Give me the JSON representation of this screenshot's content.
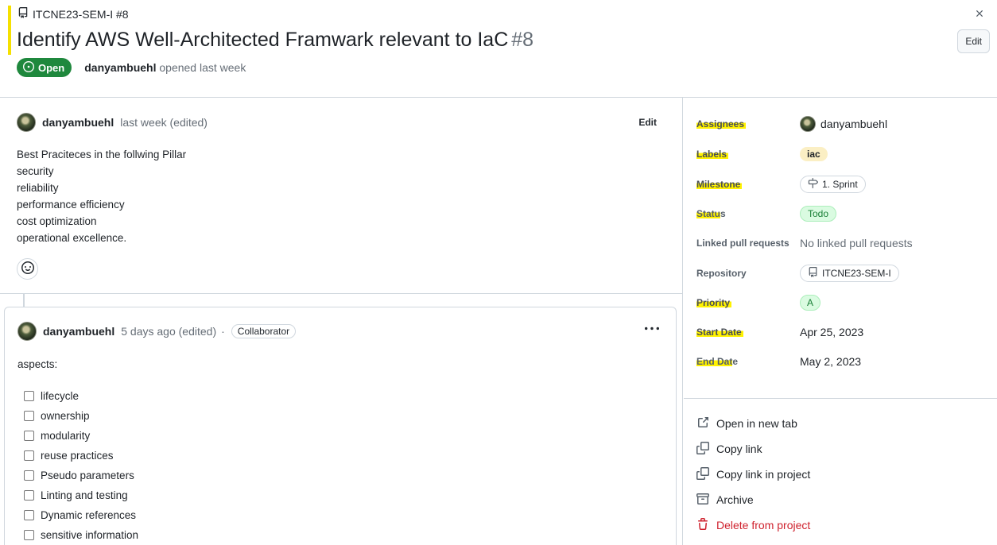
{
  "header": {
    "repo_ref": "ITCNE23-SEM-I #8",
    "title": "Identify AWS Well-Architected Framwark relevant to IaC",
    "number": "#8",
    "edit_label": "Edit",
    "state": "Open",
    "author": "danyambuehl",
    "opened_text": "opened last week"
  },
  "comment1": {
    "author": "danyambuehl",
    "meta": "last week (edited)",
    "edit_label": "Edit",
    "body_lines": [
      "Best Praciteces in the follwing Pillar",
      "security",
      "reliability",
      "performance efficiency",
      "cost optimization",
      "operational excellence."
    ]
  },
  "comment2": {
    "author": "danyambuehl",
    "meta": "5 days ago (edited)",
    "separator": "·",
    "badge": "Collaborator",
    "intro": "aspects:",
    "tasks": [
      "lifecycle",
      "ownership",
      "modularity",
      "reuse practices",
      "Pseudo parameters",
      "Linting and testing",
      "Dynamic references",
      "sensitive information"
    ]
  },
  "sidebar": {
    "assignees_label": "Assignees",
    "assignee": "danyambuehl",
    "labels_label": "Labels",
    "label_value": "iac",
    "milestone_label": "Milestone",
    "milestone_value": "1. Sprint",
    "status_label_a": "Statu",
    "status_label_b": "s",
    "status_value": "Todo",
    "linked_pr_label": "Linked pull requests",
    "linked_pr_value": "No linked pull requests",
    "repository_label": "Repository",
    "repository_value": "ITCNE23-SEM-I",
    "priority_label": "Priority",
    "priority_value": "A",
    "start_label_a": "Start Date",
    "start_value": "Apr 25, 2023",
    "end_label_a": "End Dat",
    "end_label_b": "e",
    "end_value": "May 2, 2023",
    "actions": {
      "open_new_tab": "Open in new tab",
      "copy_link": "Copy link",
      "copy_link_project": "Copy link in project",
      "archive": "Archive",
      "delete": "Delete from project"
    }
  },
  "colors": {
    "open_green": "#1f883d",
    "highlight_yellow": "#fff200",
    "danger_red": "#cf222e",
    "label_iac_bg": "#fbefc4"
  }
}
